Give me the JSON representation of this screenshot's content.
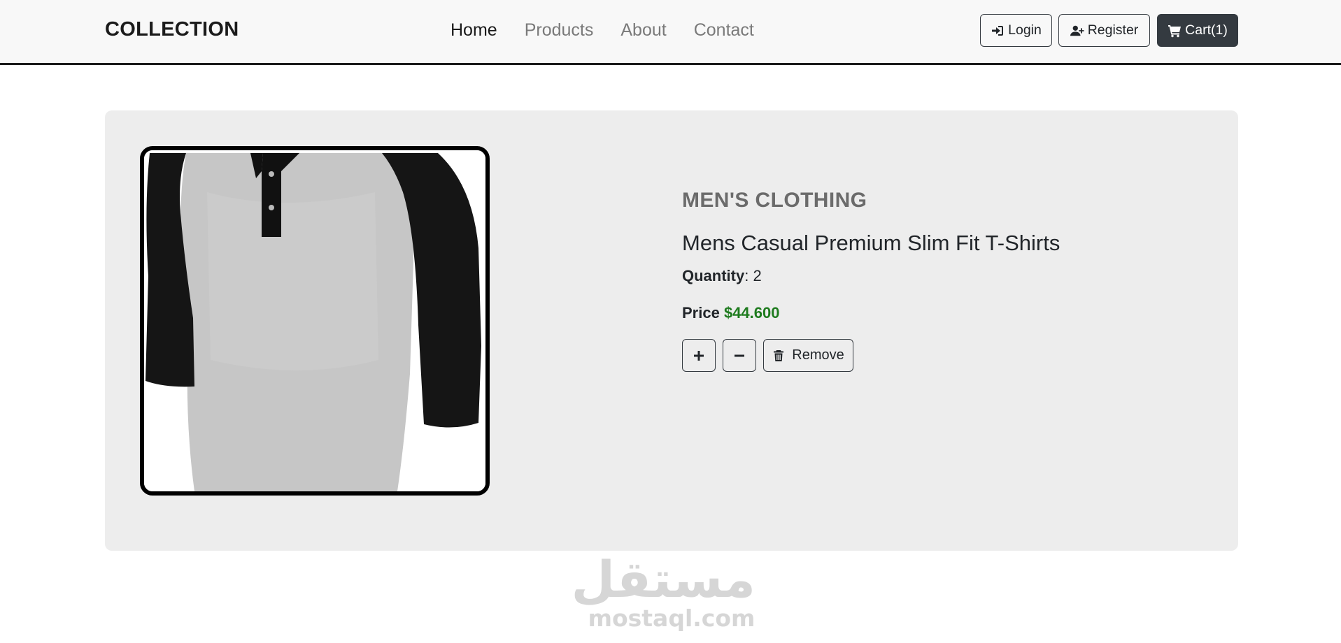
{
  "nav": {
    "brand": "COLLECTION",
    "links": [
      "Home",
      "Products",
      "About",
      "Contact"
    ],
    "active_link": "Home",
    "login_label": "Login",
    "register_label": "Register",
    "cart_label": "Cart(1)"
  },
  "product": {
    "category": "MEN'S CLOTHING",
    "title": "Mens Casual Premium Slim Fit T-Shirts",
    "quantity_label": "Quantity",
    "quantity_value": ": 2",
    "price_label": "Price",
    "price_value": "$44.600",
    "increase_symbol": "+",
    "decrease_symbol": "−",
    "remove_label": "Remove",
    "image_icon": "raglan-tshirt-image"
  },
  "watermark": {
    "arabic": "مستقل",
    "latin": "mostaql.com"
  },
  "colors": {
    "navbar_bg": "#f8f8f8",
    "card_bg": "#ededed",
    "cart_button_bg": "#343a40",
    "price_green": "#1e7b1e",
    "category_gray": "#6b6b6b"
  }
}
